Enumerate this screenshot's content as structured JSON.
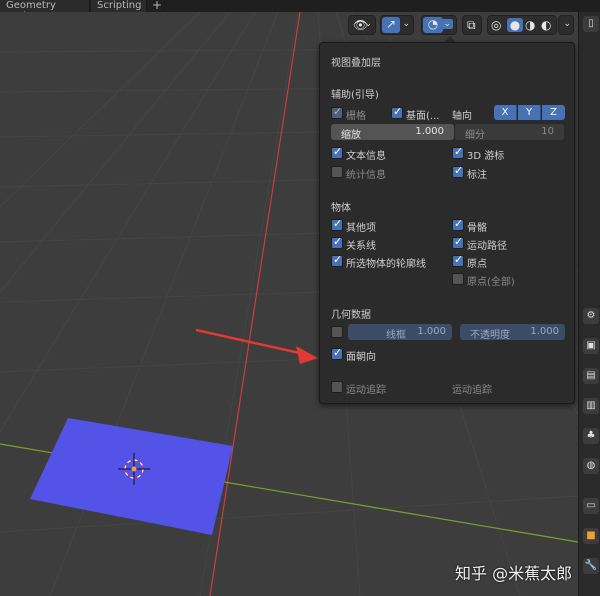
{
  "tabs": [
    "Geometry Nodes",
    "Scripting",
    "+"
  ],
  "header_icons": [
    "eye-icon",
    "gizmo-icon",
    "overlay-icon",
    "xray-icon",
    "wireframe-shading-icon",
    "solid-shading-icon",
    "material-shading-icon",
    "rendered-shading-icon"
  ],
  "colors": {
    "accent": "#4772b3",
    "face_orientation_front": "#5353e8",
    "arrow": "#e23a32",
    "x_axis": "#cc3c3c",
    "y_axis": "#7aa02e"
  },
  "overlay": {
    "title": "视图叠加层",
    "guides_header": "辅助(引导)",
    "grid": {
      "label": "栅格",
      "checked": true,
      "disabled": true
    },
    "floor": {
      "label": "基面(...",
      "checked": true
    },
    "axes_label": "轴向",
    "axes": [
      "X",
      "Y",
      "Z"
    ],
    "scale": {
      "label": "缩放",
      "value": "1.000"
    },
    "subdivisions": {
      "label": "细分",
      "value": "10"
    },
    "text_info": {
      "label": "文本信息",
      "checked": true
    },
    "cursor_3d": {
      "label": "3D 游标",
      "checked": true
    },
    "statistics": {
      "label": "统计信息",
      "checked": false
    },
    "annotations": {
      "label": "标注",
      "checked": true
    },
    "objects_header": "物体",
    "extras": {
      "label": "其他项",
      "checked": true
    },
    "bones": {
      "label": "骨骼",
      "checked": true
    },
    "relationships": {
      "label": "关系线",
      "checked": true
    },
    "motion_paths": {
      "label": "运动路径",
      "checked": true
    },
    "outline_selected": {
      "label": "所选物体的轮廓线",
      "checked": true
    },
    "origins": {
      "label": "原点",
      "checked": true
    },
    "origins_all": {
      "label": "原点(全部)",
      "checked": false
    },
    "geometry_header": "几何数据",
    "wireframe": {
      "label": "线框",
      "value": "1.000",
      "checked": false
    },
    "opacity": {
      "label": "不透明度",
      "value": "1.000"
    },
    "face_orientation": {
      "label": "面朝向",
      "checked": true
    },
    "motion_tracking": {
      "label": "运动追踪",
      "checked": false
    },
    "motion_tracking_right": "运动追踪"
  },
  "watermark": "知乎 @米蕉太郎"
}
